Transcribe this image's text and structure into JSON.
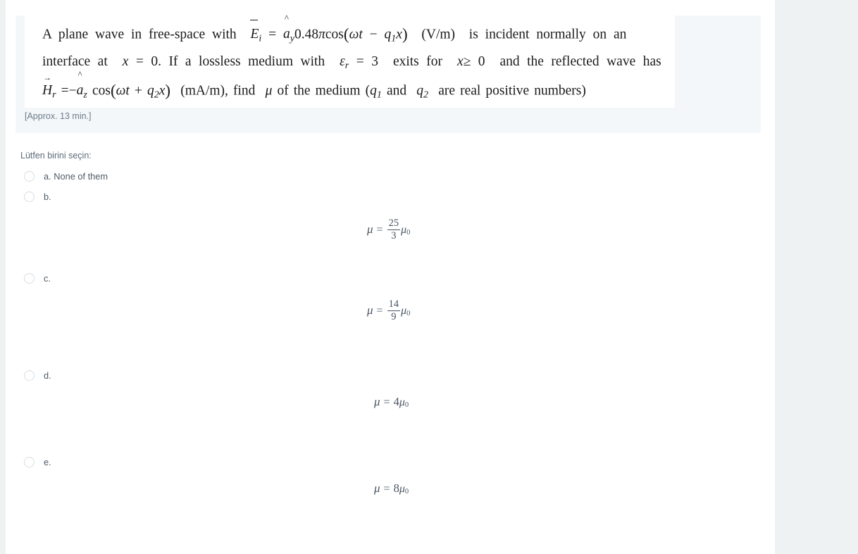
{
  "page": {
    "background_color": "#eff2f3",
    "card_background": "#ffffff",
    "question_box_color": "#f4f7fa"
  },
  "question": {
    "line1_a": "A  plane  wave  in  free-space  with",
    "line1_vecE": "E",
    "line1_sub_i": "i",
    "line1_eq": "=",
    "line1_ahat": "a",
    "line1_sub_y": "y",
    "line1_amp": "0.48",
    "line1_pi": "π",
    "line1_cos": "cos",
    "line1_omega": "ω",
    "line1_t": "t",
    "line1_minus": "−",
    "line1_q": "q",
    "line1_sub_1": "1",
    "line1_x": "x",
    "line1_units": "(V/m)",
    "line1_b": "is  incident  normally  on  an",
    "line2_a": "interface  at",
    "line2_x": "x",
    "line2_eq0": "= 0",
    "line2_period": ".",
    "line2_b": "If  a  lossless  medium  with",
    "line2_eps": "ε",
    "line2_sub_r": "r",
    "line2_eq3": "= 3",
    "line2_c": "exits  for",
    "line2_xge0_x": "x",
    "line2_xge0": "≥ 0",
    "line2_d": "and  the  reflected  wave  has",
    "line3_vecH": "H",
    "line3_sub_r": "r",
    "line3_eq": "=",
    "line3_minus": "−",
    "line3_ahat": "a",
    "line3_sub_z": "z",
    "line3_cos": "cos",
    "line3_omega": "ω",
    "line3_t": "t",
    "line3_plus": "+",
    "line3_q": "q",
    "line3_sub_2": "2",
    "line3_x": "x",
    "line3_units": "(mA/m), find",
    "line3_mu": "μ",
    "line3_b": "of the medium (",
    "line3_q1": "q",
    "line3_q1sub": "1",
    "line3_and": "and",
    "line3_q2": "q",
    "line3_q2sub": "2",
    "line3_c": "are real positive numbers)"
  },
  "approx_note": "[Approx. 13 min.]",
  "select_prompt": "Lütfen birini seçin:",
  "options": [
    {
      "key": "a",
      "label": "a. None of them",
      "selected": false,
      "math": null
    },
    {
      "key": "b",
      "label": "b.",
      "selected": false,
      "math": {
        "mu": "μ",
        "eq": "=",
        "numerator": "25",
        "denominator": "3",
        "whole": null,
        "mu0": "μ",
        "mu0_sub": "0"
      }
    },
    {
      "key": "c",
      "label": "c.",
      "selected": false,
      "math": {
        "mu": "μ",
        "eq": "=",
        "numerator": "14",
        "denominator": "9",
        "whole": null,
        "mu0": "μ",
        "mu0_sub": "0"
      }
    },
    {
      "key": "d",
      "label": "d.",
      "selected": false,
      "math": {
        "mu": "μ",
        "eq": "=",
        "numerator": null,
        "denominator": null,
        "whole": "4",
        "mu0": "μ",
        "mu0_sub": "0"
      }
    },
    {
      "key": "e",
      "label": "e.",
      "selected": false,
      "math": {
        "mu": "μ",
        "eq": "=",
        "numerator": null,
        "denominator": null,
        "whole": "8",
        "mu0": "μ",
        "mu0_sub": "0"
      }
    }
  ]
}
